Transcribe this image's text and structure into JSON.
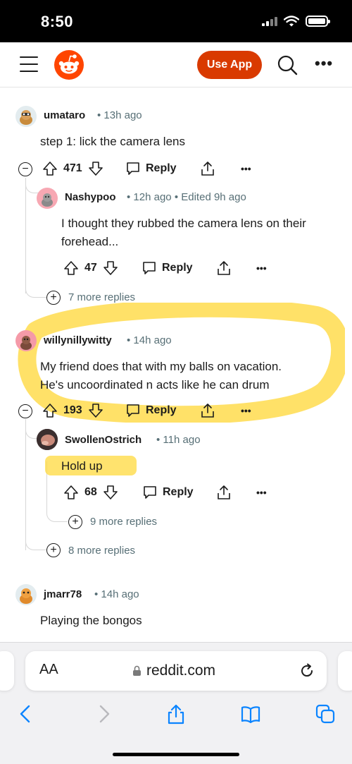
{
  "status_bar": {
    "time": "8:50"
  },
  "header": {
    "use_app_label": "Use App"
  },
  "comments": [
    {
      "username": "umataro",
      "time": "13h ago",
      "body": [
        "step 1: lick the camera lens"
      ],
      "votes": "471",
      "reply_label": "Reply"
    },
    {
      "username": "Nashypoo",
      "time": "12h ago",
      "edited": "Edited 9h ago",
      "body": [
        "I thought they rubbed the camera lens on their",
        "forehead..."
      ],
      "votes": "47",
      "reply_label": "Reply",
      "more_replies": "7 more replies"
    },
    {
      "username": "willynillywitty",
      "time": "14h ago",
      "body": [
        "My friend does that with my balls on vacation.",
        "He's uncoordinated n acts like he can drum"
      ],
      "votes": "193",
      "reply_label": "Reply"
    },
    {
      "username": "SwollenOstrich",
      "time": "11h ago",
      "body": [
        "Hold up"
      ],
      "votes": "68",
      "reply_label": "Reply",
      "more_replies": "9 more replies"
    },
    {
      "username": "jmarr78",
      "time": "14h ago",
      "body": [
        "Playing the bongos"
      ],
      "parent_more_replies": "8 more replies"
    }
  ],
  "browser": {
    "text_size_label": "AA",
    "url": "reddit.com"
  },
  "colors": {
    "accent": "#d93a00",
    "highlight": "#ffd93d",
    "link_blue": "#0a84ff"
  }
}
